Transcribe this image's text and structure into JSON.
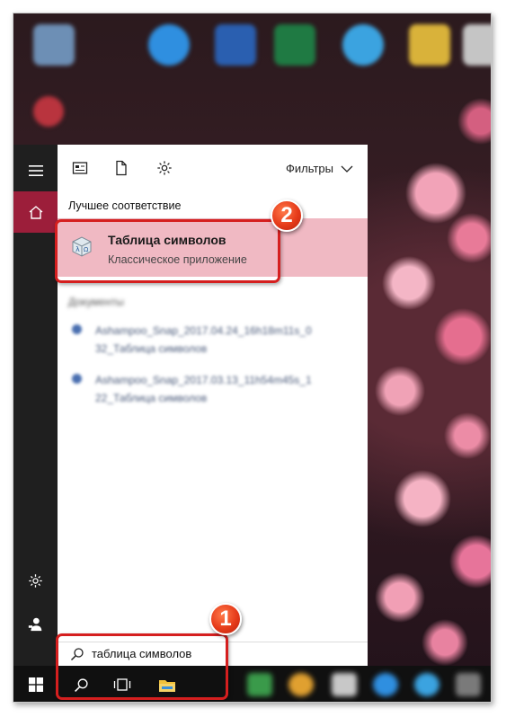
{
  "toolbar": {
    "filters_label": "Фильтры"
  },
  "results": {
    "best_match_header": "Лучшее соответствие",
    "best_match": {
      "title": "Таблица символов",
      "subtitle": "Классическое приложение",
      "icon": "charmap-app-icon"
    },
    "documents_header": "Документы",
    "documents": [
      {
        "line1": "Ashampoo_Snap_2017.04.24_16h18m11s_0",
        "line2": "32_Таблица символов"
      },
      {
        "line1": "Ashampoo_Snap_2017.03.13_11h54m45s_1",
        "line2": "22_Таблица символов"
      }
    ]
  },
  "search": {
    "query": "таблица символов",
    "icon": "search-icon"
  },
  "annotations": {
    "step1": "1",
    "step2": "2"
  },
  "colors": {
    "rail_bg": "#1f1f1f",
    "rail_active": "#9c1e3a",
    "best_match_bg": "#f0b9c3",
    "annotation_red": "#d51f1f",
    "taskbar_bg": "#101010"
  }
}
